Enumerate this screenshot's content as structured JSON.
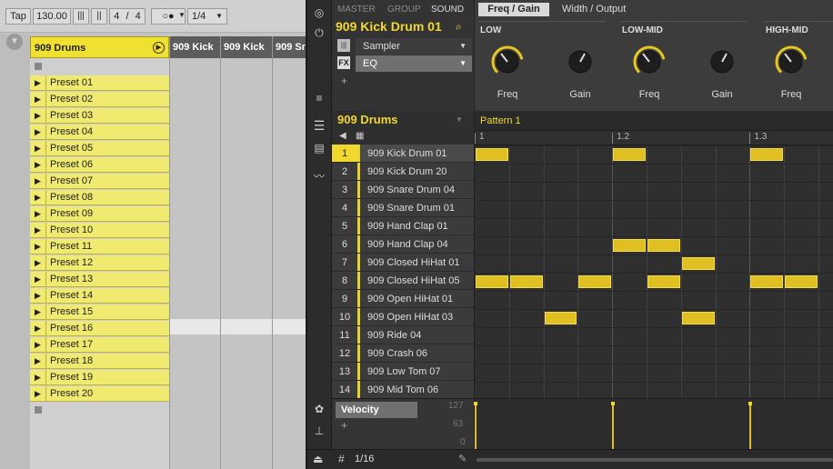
{
  "live": {
    "toolbar": {
      "tap": "Tap",
      "tempo": "130.00",
      "sig_num": "4",
      "sig_sep": "/",
      "sig_den": "4",
      "quant": "1/4"
    },
    "track_name": "909 Drums",
    "presets": [
      "Preset 01",
      "Preset 02",
      "Preset 03",
      "Preset 04",
      "Preset 05",
      "Preset 06",
      "Preset 07",
      "Preset 08",
      "Preset 09",
      "Preset 10",
      "Preset 11",
      "Preset 12",
      "Preset 13",
      "Preset 14",
      "Preset 15",
      "Preset 16",
      "Preset 17",
      "Preset 18",
      "Preset 19",
      "Preset 20"
    ],
    "kit_columns": [
      "909 Kick",
      "909 Kick",
      "909 Sn"
    ]
  },
  "maschine": {
    "nav": {
      "master": "MASTER",
      "group": "GROUP",
      "sound": "SOUND"
    },
    "sound_name": "909 Kick Drum 01",
    "plugins": [
      {
        "slot": "Sampler"
      },
      {
        "slot": "EQ"
      }
    ],
    "fx_label": "FX",
    "add_plugin": "+",
    "tabs": [
      "Freq / Gain",
      "Width / Output"
    ],
    "bands": [
      {
        "name": "LOW",
        "knobs": [
          "Freq",
          "Gain"
        ]
      },
      {
        "name": "LOW-MID",
        "knobs": [
          "Freq",
          "Gain"
        ]
      },
      {
        "name": "HIGH-MID",
        "knobs": [
          "Freq"
        ]
      }
    ],
    "group_name": "909 Drums",
    "pattern_name": "Pattern 1",
    "ruler": [
      "1",
      "1.2",
      "1.3"
    ],
    "sounds": [
      {
        "n": "1",
        "name": "909 Kick Drum 01"
      },
      {
        "n": "2",
        "name": "909 Kick Drum 20"
      },
      {
        "n": "3",
        "name": "909 Snare Drum 04"
      },
      {
        "n": "4",
        "name": "909 Snare Drum 01"
      },
      {
        "n": "5",
        "name": "909 Hand Clap 01"
      },
      {
        "n": "6",
        "name": "909 Hand Clap 04"
      },
      {
        "n": "7",
        "name": "909 Closed HiHat 01"
      },
      {
        "n": "8",
        "name": "909 Closed HiHat 05"
      },
      {
        "n": "9",
        "name": "909 Open HiHat 01"
      },
      {
        "n": "10",
        "name": "909 Open HiHat 03"
      },
      {
        "n": "11",
        "name": "909 Ride 04"
      },
      {
        "n": "12",
        "name": "909 Crash 06"
      },
      {
        "n": "13",
        "name": "909 Low Tom 07"
      },
      {
        "n": "14",
        "name": "909 Mid Tom 06"
      }
    ],
    "notes": [
      {
        "row": 0,
        "steps": [
          0,
          4,
          8
        ]
      },
      {
        "row": 5,
        "steps": [
          4,
          5
        ]
      },
      {
        "row": 6,
        "steps": [
          6
        ]
      },
      {
        "row": 7,
        "steps": [
          0,
          1,
          3,
          5,
          8,
          9
        ]
      },
      {
        "row": 9,
        "steps": [
          2,
          6
        ]
      }
    ],
    "velocity": {
      "label": "Velocity",
      "max": "127",
      "mid": "63",
      "min": "0",
      "add": "+"
    },
    "grid_res": "1/16",
    "colors": {
      "accent": "#f0d830",
      "note": "#e0c020"
    }
  }
}
